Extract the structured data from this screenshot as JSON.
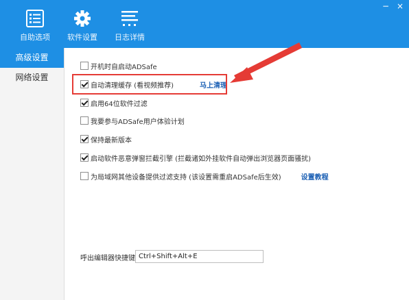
{
  "toolbar": {
    "items": [
      {
        "label": "自助选项",
        "icon": "checklist-icon"
      },
      {
        "label": "软件设置",
        "icon": "gear-icon"
      },
      {
        "label": "日志详情",
        "icon": "log-list-icon"
      }
    ]
  },
  "window": {
    "minimize": "−",
    "close": "×"
  },
  "sidebar": {
    "items": [
      {
        "label": "高级设置",
        "active": true
      },
      {
        "label": "网络设置",
        "active": false
      }
    ]
  },
  "settings": [
    {
      "label": "开机时自启动ADSafe",
      "checked": false
    },
    {
      "label": "自动清理缓存 (看视频推荐)",
      "checked": true,
      "action": "马上清理"
    },
    {
      "label": "启用64位软件过滤",
      "checked": true
    },
    {
      "label": "我要参与ADSafe用户体验计划",
      "checked": false
    },
    {
      "label": "保持最新版本",
      "checked": true
    },
    {
      "label": "启动软件恶意弹窗拦截引擎 (拦截诸如外挂软件自动弹出浏览器页面骚扰)",
      "checked": true
    },
    {
      "label": "为局域网其他设备提供过滤支持 (该设置需重启ADSafe后生效)",
      "checked": false,
      "action": "设置教程"
    }
  ],
  "hotkey": {
    "label": "呼出编辑器快捷键",
    "value": "Ctrl+Shift+Alt+E"
  },
  "colors": {
    "accent": "#1e8fe4",
    "highlight_box": "#e53b35",
    "link": "#1a5fb4"
  }
}
